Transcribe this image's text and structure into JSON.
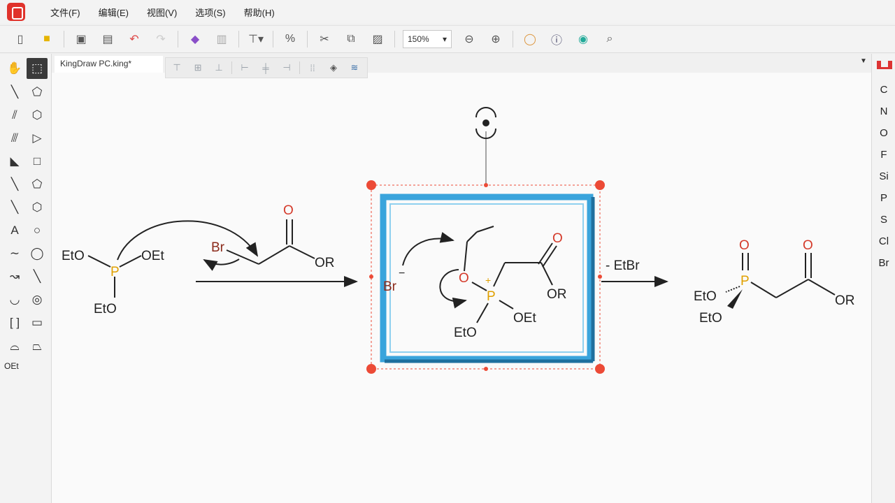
{
  "menu": {
    "file": "文件(F)",
    "edit": "编辑(E)",
    "view": "视图(V)",
    "options": "选项(S)",
    "help": "帮助(H)"
  },
  "toolbar": {
    "zoom": "150%",
    "icons": [
      "new-file-icon",
      "open-folder-icon",
      "save-icon",
      "save-as-icon",
      "undo-icon",
      "redo-icon",
      "eraser-icon",
      "delete-icon",
      "align-icon",
      "percent-icon",
      "cut-icon",
      "copy-icon",
      "paste-icon",
      "zoom-out-icon",
      "zoom-in-icon",
      "ring-icon",
      "info-icon",
      "3d-icon",
      "search-icon"
    ]
  },
  "document": {
    "tab_title": "KingDraw PC.king*"
  },
  "left_palette": {
    "text_tool": "A",
    "oet_label": "OEt"
  },
  "right_palette": {
    "elements": [
      "C",
      "N",
      "O",
      "F",
      "Si",
      "P",
      "S",
      "Cl",
      "Br"
    ]
  },
  "reaction": {
    "reactant1": {
      "label_eto_left": "EtO",
      "label_oet": "OEt",
      "label_eto_bottom": "EtO",
      "atom_p": "P"
    },
    "reactant2": {
      "label_br": "Br",
      "label_o": "O",
      "label_or": "OR"
    },
    "intermediate": {
      "label_br": "Br",
      "charge_minus": "−",
      "label_o_ring": "O",
      "label_p": "P",
      "charge_plus": "+",
      "label_o_carbonyl": "O",
      "label_or": "OR",
      "label_eto": "EtO",
      "label_oet": "OEt"
    },
    "elimination_text": "- EtBr",
    "product": {
      "label_o_p": "O",
      "label_p": "P",
      "label_o_carbonyl": "O",
      "label_eto_top": "EtO",
      "label_eto_bottom": "EtO",
      "label_or": "OR"
    }
  },
  "colors": {
    "phosphorus": "#e0a000",
    "oxygen": "#d43a2a",
    "bromine": "#8b2a1a",
    "selection_box": "#3aa4dc",
    "selection_handle": "#ec4a36",
    "logo": "#e0322b"
  }
}
